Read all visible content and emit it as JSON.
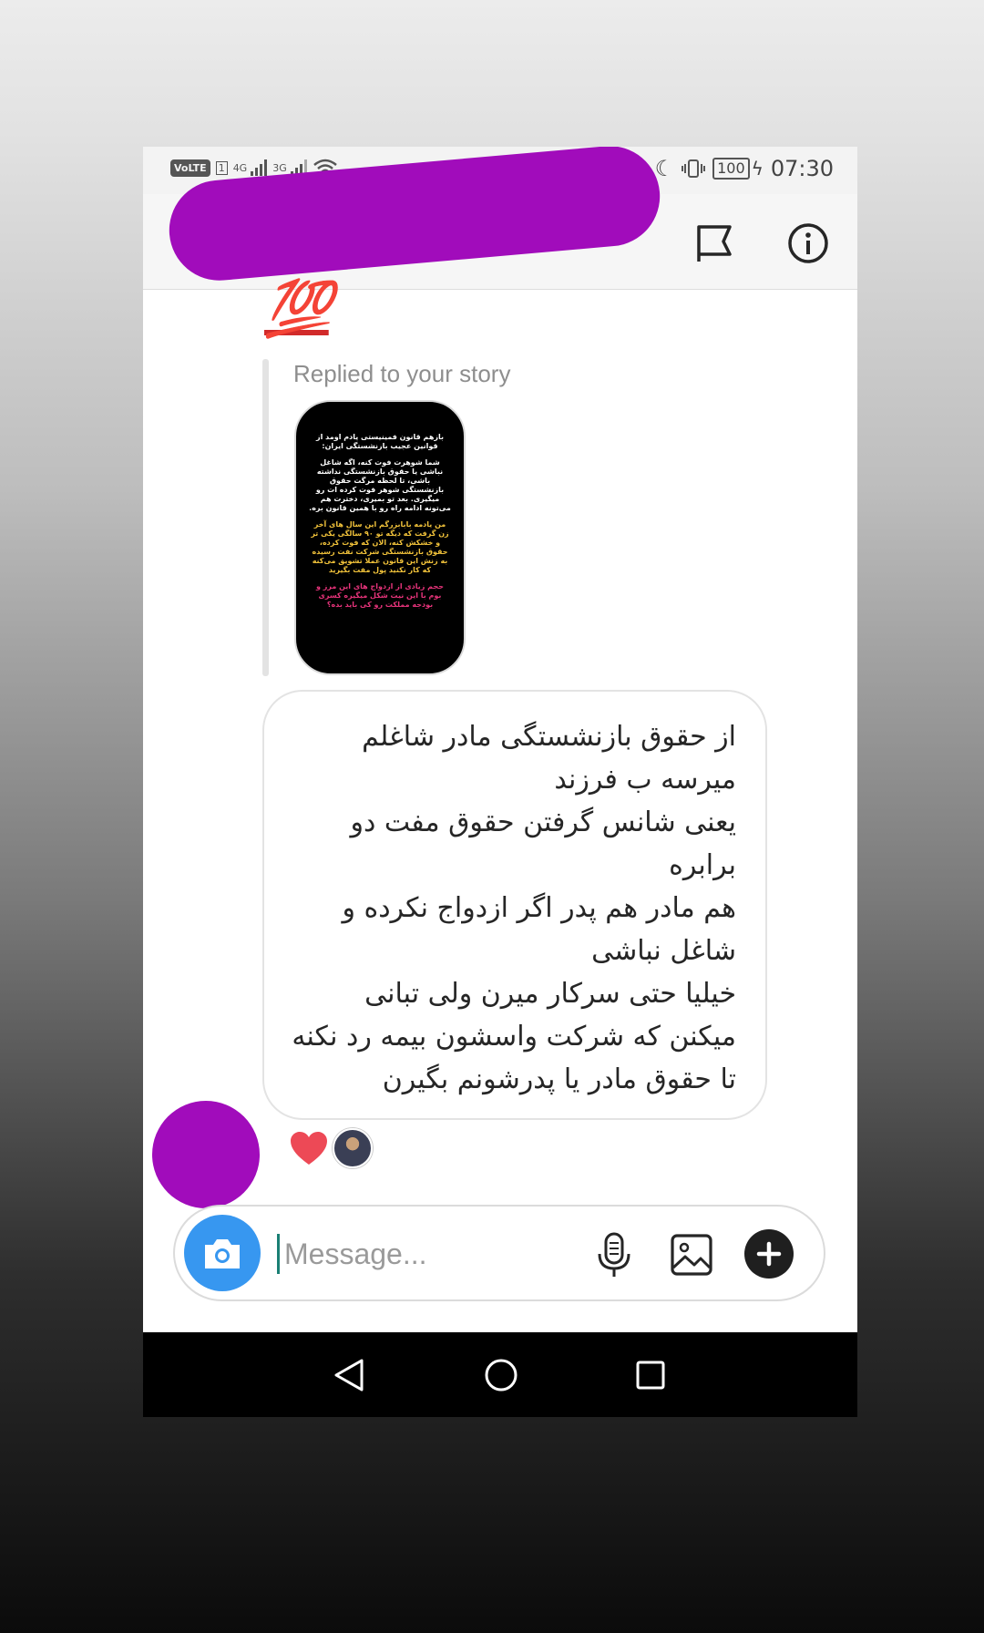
{
  "status_bar": {
    "volte": "VoLTE",
    "sim_slot": "1",
    "net1": "4G",
    "net2": "3G",
    "battery": "100",
    "time": "07:30"
  },
  "header": {
    "flag_icon": "flag-icon",
    "info_icon": "info-icon"
  },
  "messages": {
    "emoji": "💯",
    "reply_label": "Replied to your story",
    "story_preview": {
      "block1": "بازهم قانون فمینیستی یادم اومد از قوانین عجیب بازنشستگی ایران:",
      "block2": "شما شوهرت فوت کنه، اگه شاغل نباشی یا حقوق بازنشستگی نداشته باشی، تا لحظه مرگت حقوق بازنشستگی شوهر فوت کرده ات رو میگیری. بعد تو بمیری، دخترت هم می‌تونه ادامه راه رو با همین قانون بره.",
      "block3": "من یادمه بابابزرگم این سال های آخر زن گرفت که دیگه تو ۹۰ سالگی یکی تر و خشکش کنه، الان که فوت کرده، حقوق بازنشستگی شرکت نفت رسیده به زنش این قانون عملا تشویق می‌کنه که کار نکنید پول مفت بگیرید",
      "block4": "حجم زیادی از ازدواج های این مرز و بوم با این نیت شکل میگیره کسری بودجه مملکت رو کی باید بده؟"
    },
    "bubble_lines": [
      "از حقوق بازنشستگی مادر شاغلم",
      "میرسه ب فرزند",
      "یعنی شانس گرفتن حقوق مفت دو",
      "برابره",
      "هم مادر هم پدر اگر ازدواج نکرده و",
      "شاغل نباشی",
      "خیلیا حتی سرکار میرن ولی تبانی",
      "میکنن که شرکت واسشون بیمه رد نکنه",
      "تا حقوق مادر یا پدرشونم بگیرن"
    ],
    "reaction": "heart"
  },
  "composer": {
    "placeholder": "Message..."
  },
  "colors": {
    "accent_blue": "#3797f0",
    "redaction": "#a10cbb",
    "heart": "#ed4956"
  }
}
